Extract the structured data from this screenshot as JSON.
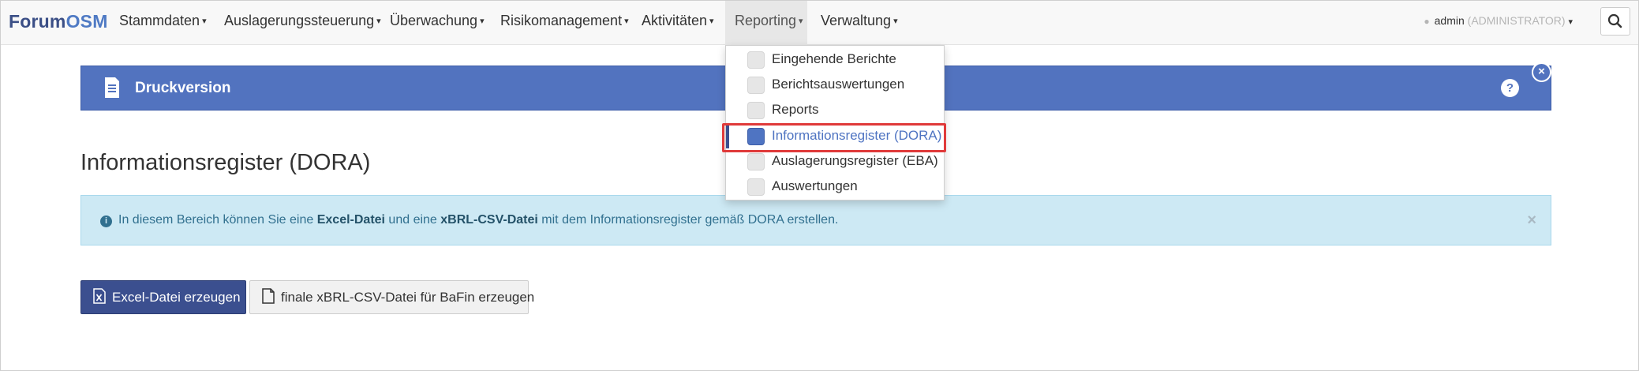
{
  "brand": {
    "part1": "Forum",
    "part2": "OSM"
  },
  "nav": {
    "items": [
      {
        "label": "Stammdaten"
      },
      {
        "label": "Auslagerungssteuerung"
      },
      {
        "label": "Überwachung"
      },
      {
        "label": "Risikomanagement"
      },
      {
        "label": "Aktivitäten"
      },
      {
        "label": "Reporting"
      },
      {
        "label": "Verwaltung"
      }
    ],
    "caret": "▾"
  },
  "user": {
    "name": "admin",
    "role": "(ADMINISTRATOR)"
  },
  "panel": {
    "title": "Druckversion",
    "help": "?",
    "close": "×"
  },
  "page": {
    "heading": "Informationsregister (DORA)"
  },
  "alert": {
    "text1": "In diesem Bereich können Sie eine ",
    "bold1": "Excel-Datei",
    "text2": " und eine ",
    "bold2": "xBRL-CSV-Datei",
    "text3": " mit dem Informationsregister gemäß DORA erstellen.",
    "info": "i",
    "close": "×"
  },
  "buttons": {
    "excel": "Excel-Datei erzeugen",
    "xbrl": "finale xBRL-CSV-Datei für BaFin erzeugen"
  },
  "dropdown": {
    "items": [
      {
        "label": "Eingehende Berichte"
      },
      {
        "label": "Berichtsauswertungen"
      },
      {
        "label": "Reports"
      },
      {
        "label": "Informationsregister (DORA)"
      },
      {
        "label": "Auslagerungsregister (EBA)"
      },
      {
        "label": "Auswertungen"
      }
    ]
  },
  "colors": {
    "primary": "#3b4f8f",
    "panel": "#5273bf",
    "alert_bg": "#cde9f4",
    "highlight": "#e03a3a"
  }
}
